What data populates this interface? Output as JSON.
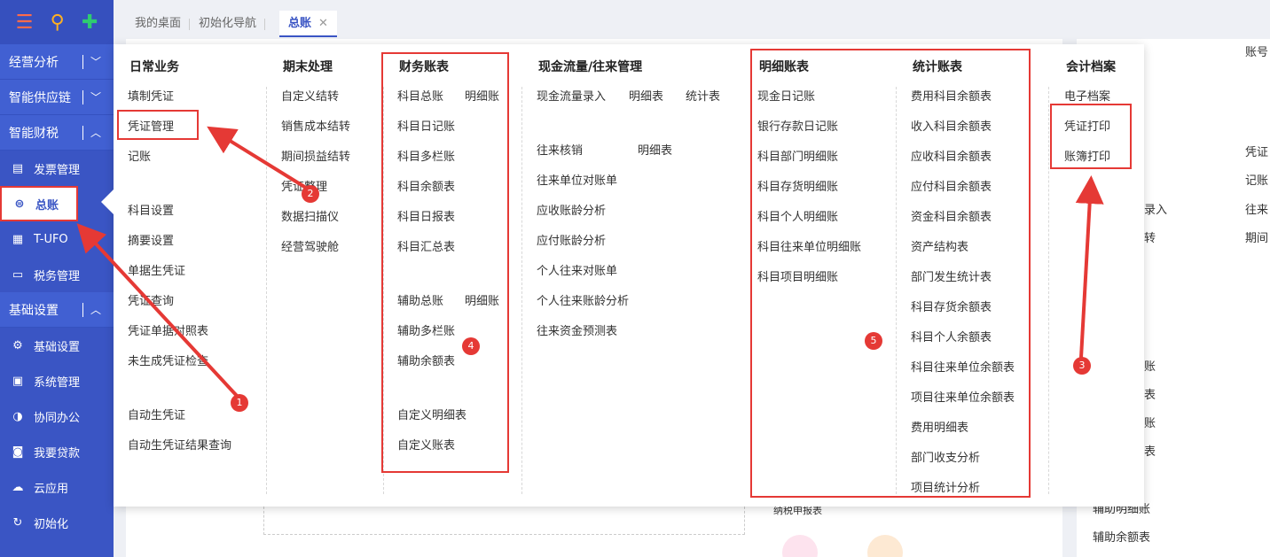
{
  "sidebar": {
    "groups": [
      {
        "label": "经营分析"
      },
      {
        "label": "智能供应链"
      },
      {
        "label": "智能财税"
      }
    ],
    "items": [
      {
        "label": "发票管理",
        "icon": "invoice-icon"
      },
      {
        "label": "总账",
        "icon": "ledger-icon"
      },
      {
        "label": "T-UFO",
        "icon": "building-icon"
      },
      {
        "label": "税务管理",
        "icon": "tax-icon"
      }
    ],
    "group2": {
      "label": "基础设置"
    },
    "items2": [
      {
        "label": "基础设置",
        "icon": "gear-icon"
      },
      {
        "label": "系统管理",
        "icon": "monitor-icon"
      },
      {
        "label": "协同办公",
        "icon": "collab-icon"
      },
      {
        "label": "我要贷款",
        "icon": "wallet-icon"
      },
      {
        "label": "云应用",
        "icon": "cloud-icon"
      },
      {
        "label": "初始化",
        "icon": "refresh-icon"
      }
    ]
  },
  "tabs": [
    {
      "label": "我的桌面"
    },
    {
      "label": "初始化导航"
    },
    {
      "label": "总账"
    }
  ],
  "menu": {
    "daily": {
      "title": "日常业务",
      "items": [
        "填制凭证",
        "凭证管理",
        "记账",
        "科目设置",
        "摘要设置",
        "单据生凭证",
        "凭证查询",
        "凭证单据对照表",
        "未生成凭证检查",
        "自动生凭证",
        "自动生凭证结果查询"
      ]
    },
    "period": {
      "title": "期末处理",
      "items": [
        "自定义结转",
        "销售成本结转",
        "期间损益结转",
        "凭证整理",
        "数据扫描仪",
        "经营驾驶舱"
      ]
    },
    "reports": {
      "title": "财务账表",
      "items": [
        "科目总账",
        "明细账",
        "科目日记账",
        "科目多栏账",
        "科目余额表",
        "科目日报表",
        "科目汇总表",
        "辅助总账",
        "明细账",
        "辅助多栏账",
        "辅助余额表",
        "自定义明细表",
        "自定义账表"
      ]
    },
    "cashflow": {
      "title": "现金流量/往来管理",
      "items": [
        "现金流量录入",
        "明细表",
        "统计表",
        "往来核销",
        "明细表",
        "往来单位对账单",
        "应收账龄分析",
        "应付账龄分析",
        "个人往来对账单",
        "个人往来账龄分析",
        "往来资金预测表"
      ]
    },
    "detail": {
      "title": "明细账表",
      "items": [
        "现金日记账",
        "银行存款日记账",
        "科目部门明细账",
        "科目存货明细账",
        "科目个人明细账",
        "科目往来单位明细账",
        "科目项目明细账"
      ]
    },
    "stats": {
      "title": "统计账表",
      "items": [
        "费用科目余额表",
        "收入科目余额表",
        "应收科目余额表",
        "应付科目余额表",
        "资金科目余额表",
        "资产结构表",
        "部门发生统计表",
        "科目存货余额表",
        "科目个人余额表",
        "科目往来单位余额表",
        "项目往来单位余额表",
        "费用明细表",
        "部门收支分析",
        "项目统计分析"
      ]
    },
    "archive": {
      "title": "会计档案",
      "items": [
        "电子档案",
        "凭证打印",
        "账簿打印"
      ]
    }
  },
  "badges": [
    "1",
    "2",
    "3",
    "4",
    "5"
  ],
  "background": {
    "right_texts": [
      "账号",
      "凭证",
      "记账",
      "往来",
      "期间",
      "录入",
      "转",
      "账",
      "表",
      "账",
      "表",
      "辅助明细账",
      "辅助余额表",
      "纳税申报表"
    ]
  },
  "colors": {
    "sidebar": "#3a55c4",
    "highlight": "#e53935",
    "accent": "#3a55c4"
  }
}
